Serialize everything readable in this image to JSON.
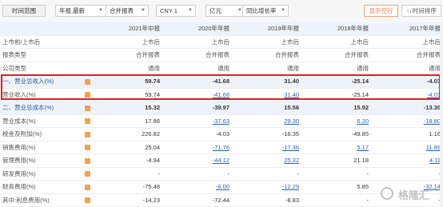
{
  "toolbar": {
    "time_range_label": "时间范围",
    "period": "年报,最新",
    "report_type": "合并报表",
    "currency": "CNY 1",
    "unit": "亿元",
    "growth": "同比增长率",
    "show_empty": "显示空行",
    "time_sort": "↑↓时间排序"
  },
  "columns": [
    "2021年中报",
    "2020年年报",
    "2019年年报",
    "2018年年报",
    "2017年年报"
  ],
  "meta_rows": [
    {
      "name": "上市前/上市后",
      "values": [
        "上市后",
        "上市后",
        "上市后",
        "上市后",
        "上市后"
      ]
    },
    {
      "name": "报表类型",
      "values": [
        "合并报表",
        "合并报表",
        "合并报表",
        "合并报表",
        "合并报表"
      ]
    },
    {
      "name": "公司类型",
      "values": [
        "通用",
        "通用",
        "通用",
        "通用",
        "通用"
      ]
    }
  ],
  "data_rows": [
    {
      "name": "一、营业总收入(%)",
      "values": [
        "59.74",
        "-41.68",
        "31.40",
        "-25.14",
        "-4.03"
      ],
      "section": true
    },
    {
      "name": "营业收入(%)",
      "values": [
        "59.74",
        "-41.68",
        "31.40",
        "-25.14",
        "-4.03"
      ],
      "links": [
        false,
        true,
        true,
        false,
        true
      ]
    },
    {
      "name": "二、营业总成本(%)",
      "values": [
        "15.32",
        "-39.97",
        "15.56",
        "15.92",
        "-13.30"
      ],
      "section": true
    },
    {
      "name": "营业成本(%)",
      "values": [
        "17.86",
        "-37.63",
        "29.30",
        "6.20",
        "-18.80"
      ],
      "links": [
        false,
        true,
        true,
        true,
        true
      ]
    },
    {
      "name": "税金及附加(%)",
      "values": [
        "226.82",
        "-4.03",
        "-16.35",
        "-49.85",
        "1.16"
      ],
      "links": [
        false,
        false,
        false,
        false,
        false
      ]
    },
    {
      "name": "销售费用(%)",
      "values": [
        "25.04",
        "-71.76",
        "-17.36",
        "5.17",
        "11.89"
      ],
      "links": [
        false,
        true,
        true,
        true,
        true
      ]
    },
    {
      "name": "管理费用(%)",
      "values": [
        "-4.94",
        "-44.12",
        "25.32",
        "21.18",
        "4.11"
      ],
      "links": [
        false,
        true,
        true,
        false,
        true
      ]
    },
    {
      "name": "研发费用(%)",
      "values": [
        "-",
        "-",
        "-",
        "-",
        "-"
      ],
      "links": [
        false,
        false,
        false,
        false,
        false
      ]
    },
    {
      "name": "财务费用(%)",
      "values": [
        "-75.48",
        "-6.00",
        "-12.29",
        "5.85",
        "-32.14"
      ],
      "links": [
        false,
        true,
        true,
        false,
        true
      ]
    },
    {
      "name": "其中:利息费用(%)",
      "values": [
        "-14.23",
        "-72.44",
        "-8.83",
        "-",
        "-"
      ],
      "links": [
        false,
        false,
        false,
        false,
        false
      ]
    }
  ],
  "watermark": "格隆汇"
}
